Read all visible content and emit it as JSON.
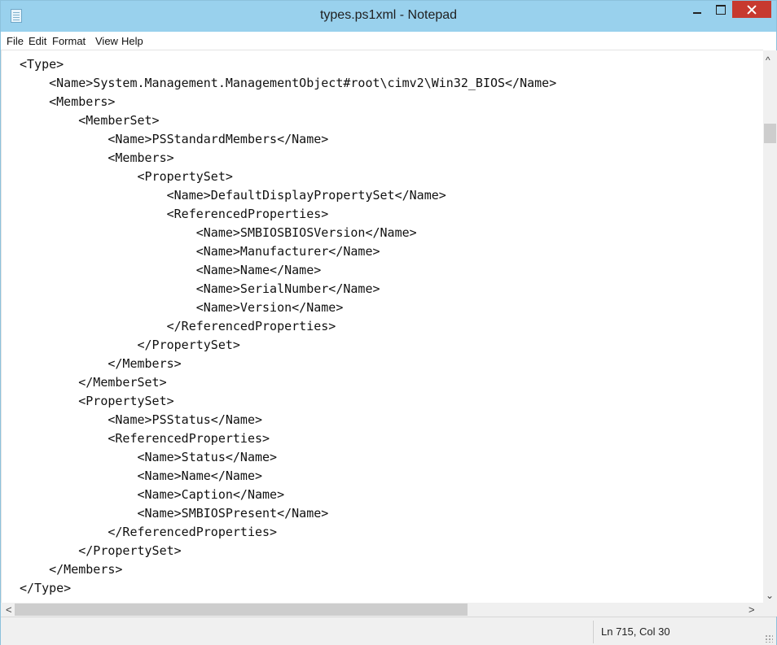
{
  "window": {
    "title": "types.ps1xml - Notepad"
  },
  "menu": {
    "file": "File",
    "edit": "Edit",
    "format": "Format",
    "view": "View",
    "help": "Help"
  },
  "editor": {
    "text": "<Type>\n    <Name>System.Management.ManagementObject#root\\cimv2\\Win32_BIOS</Name>\n    <Members>\n        <MemberSet>\n            <Name>PSStandardMembers</Name>\n            <Members>\n                <PropertySet>\n                    <Name>DefaultDisplayPropertySet</Name>\n                    <ReferencedProperties>\n                        <Name>SMBIOSBIOSVersion</Name>\n                        <Name>Manufacturer</Name>\n                        <Name>Name</Name>\n                        <Name>SerialNumber</Name>\n                        <Name>Version</Name>\n                    </ReferencedProperties>\n                </PropertySet>\n            </Members>\n        </MemberSet>\n        <PropertySet>\n            <Name>PSStatus</Name>\n            <ReferencedProperties>\n                <Name>Status</Name>\n                <Name>Name</Name>\n                <Name>Caption</Name>\n                <Name>SMBIOSPresent</Name>\n            </ReferencedProperties>\n        </PropertySet>\n    </Members>\n</Type>"
  },
  "scrollbars": {
    "vertical_up": "^",
    "vertical_down": "⌄",
    "horizontal_left": "<",
    "horizontal_right": ">"
  },
  "status": {
    "position": "Ln 715, Col 30"
  },
  "colors": {
    "titlebar": "#99d1ed",
    "close_button": "#c7392f"
  },
  "icons": [
    "notepad-icon",
    "minimize-icon",
    "maximize-icon",
    "close-icon",
    "resize-grip-icon"
  ]
}
